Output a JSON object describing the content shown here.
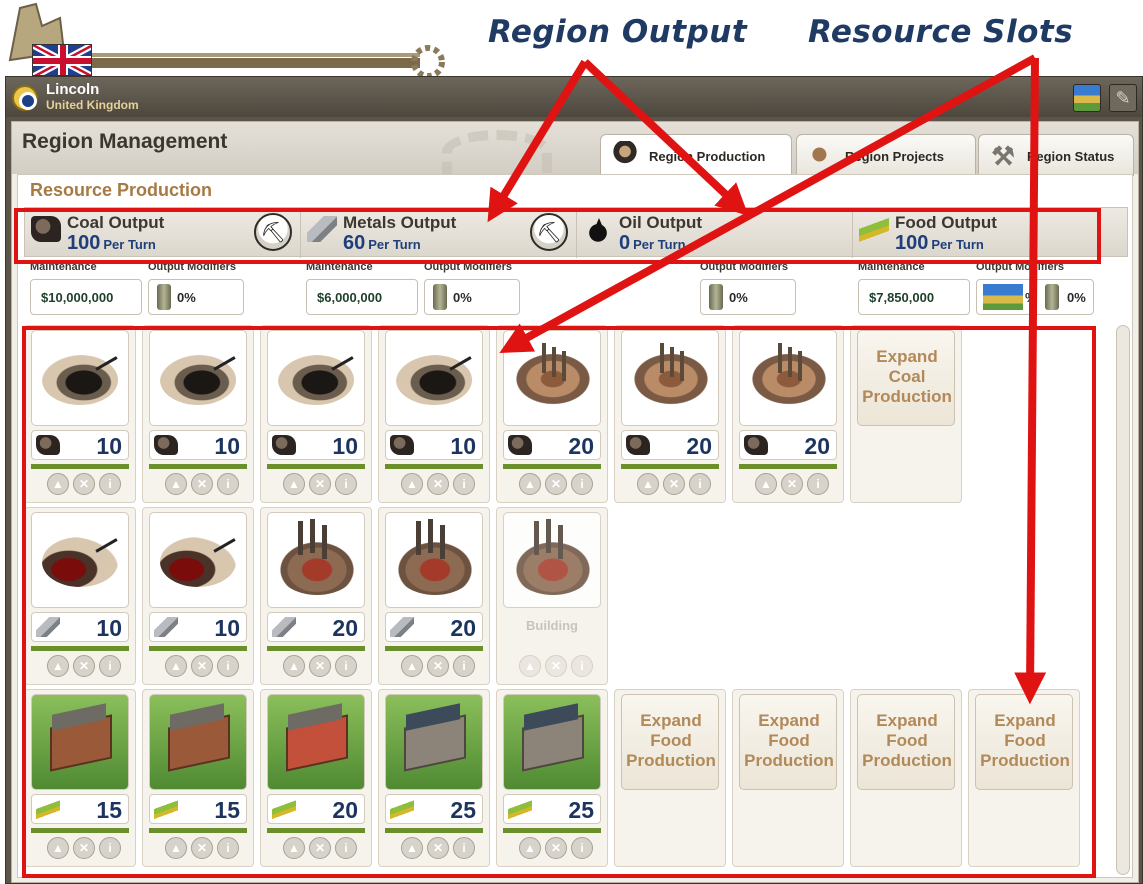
{
  "annotations": {
    "region_output": "Region Output",
    "resource_slots": "Resource Slots",
    "colors": {
      "arrow": "#e01313",
      "label": "#1f3a63"
    }
  },
  "window": {
    "region_name": "Lincoln",
    "country": "United Kingdom",
    "flag": "uk-flag"
  },
  "panel": {
    "title": "Region Management",
    "tabs": [
      {
        "label": "Region Production",
        "icon": "foreman-icon",
        "active": true
      },
      {
        "label": "Region Projects",
        "icon": "pickaxe-worker-icon",
        "active": false
      },
      {
        "label": "Region Status",
        "icon": "crossed-tools-icon",
        "active": false
      }
    ]
  },
  "section_title": "Resource Production",
  "outputs": [
    {
      "name": "Coal Output",
      "value": "100",
      "unit": "Per Turn",
      "icon": "coal-icon",
      "prospect": true
    },
    {
      "name": "Metals Output",
      "value": "60",
      "unit": "Per Turn",
      "icon": "metal-bar-icon",
      "prospect": true
    },
    {
      "name": "Oil Output",
      "value": "0",
      "unit": "Per Turn",
      "icon": "oil-drop-icon",
      "prospect": false
    },
    {
      "name": "Food Output",
      "value": "100",
      "unit": "Per Turn",
      "icon": "wheat-icon",
      "prospect": false
    }
  ],
  "labels": {
    "maintenance": "Maintenance",
    "output_modifiers": "Output Modifiers",
    "building": "Building"
  },
  "maintenance": [
    {
      "amount": "$10,000,000",
      "modifier": "0%"
    },
    {
      "amount": "$6,000,000",
      "modifier": "0%"
    },
    {
      "amount": "",
      "modifier": "0%"
    },
    {
      "amount": "$7,850,000",
      "map_modifier": "%",
      "modifier": "0%"
    }
  ],
  "rows": {
    "coal": [
      {
        "art": "coal",
        "value": "10"
      },
      {
        "art": "coal",
        "value": "10"
      },
      {
        "art": "coal",
        "value": "10"
      },
      {
        "art": "coal",
        "value": "10"
      },
      {
        "art": "metal-mine",
        "value": "20"
      },
      {
        "art": "metal-mine",
        "value": "20"
      },
      {
        "art": "metal-mine",
        "value": "20"
      }
    ],
    "coal_expand": "Expand Coal Production",
    "metals": [
      {
        "art": "coal-red",
        "value": "10"
      },
      {
        "art": "coal-red",
        "value": "10"
      },
      {
        "art": "mill",
        "value": "20"
      },
      {
        "art": "mill",
        "value": "20"
      }
    ],
    "metals_building": {
      "art": "mill"
    },
    "food": [
      {
        "art": "farm",
        "value": "15"
      },
      {
        "art": "farm",
        "value": "15"
      },
      {
        "art": "farm-red",
        "value": "20"
      },
      {
        "art": "farm-stone",
        "value": "25"
      },
      {
        "art": "farm-stone",
        "value": "25"
      }
    ],
    "food_expand": [
      "Expand Food Production",
      "Expand Food Production",
      "Expand Food Production",
      "Expand Food Production"
    ]
  },
  "slot_buttons": [
    "upgrade-icon",
    "remove-icon",
    "info-icon"
  ]
}
